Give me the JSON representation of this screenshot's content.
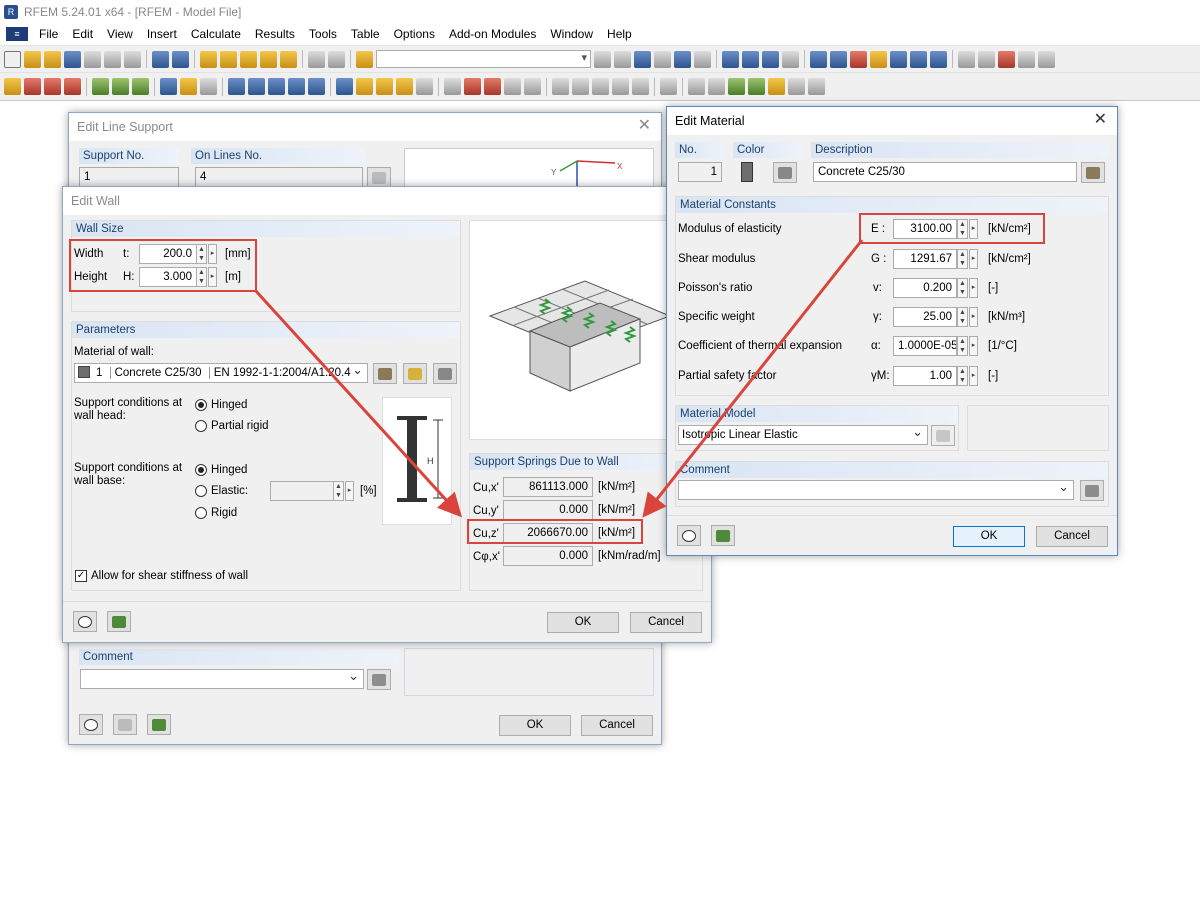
{
  "window": {
    "title": "RFEM 5.24.01 x64 - [RFEM - Model File]"
  },
  "menu": [
    "File",
    "Edit",
    "View",
    "Insert",
    "Calculate",
    "Results",
    "Tools",
    "Table",
    "Options",
    "Add-on Modules",
    "Window",
    "Help"
  ],
  "line_support": {
    "title": "Edit Line Support",
    "support_no_label": "Support No.",
    "support_no": "1",
    "on_lines_label": "On Lines No.",
    "on_lines": "4",
    "comment_label": "Comment",
    "ok": "OK",
    "cancel": "Cancel",
    "axis_y": "Y",
    "axis_x": "X"
  },
  "wall": {
    "title": "Edit Wall",
    "size_header": "Wall Size",
    "width_label": "Width",
    "width_sym": "t:",
    "width_value": "200.0",
    "width_unit": "[mm]",
    "height_label": "Height",
    "height_sym": "H:",
    "height_value": "3.000",
    "height_unit": "[m]",
    "params_header": "Parameters",
    "material_label": "Material of wall:",
    "material_no": "1",
    "material_name": "Concrete C25/30",
    "material_norm": "EN 1992-1-1:2004/A1:20.4",
    "head_label_1": "Support conditions at",
    "head_label_2": "wall head:",
    "head_hinged": "Hinged",
    "head_partial": "Partial rigid",
    "base_label_1": "Support conditions at",
    "base_label_2": "wall base:",
    "base_hinged": "Hinged",
    "base_elastic": "Elastic:",
    "base_elastic_unit": "[%]",
    "base_rigid": "Rigid",
    "shear_label": "Allow for shear stiffness of wall",
    "diagram_label": "H",
    "springs_header": "Support Springs Due to Wall",
    "springs": [
      {
        "sym": "Cu,x'",
        "value": "861113.000",
        "unit": "[kN/m²]"
      },
      {
        "sym": "Cu,y'",
        "value": "0.000",
        "unit": "[kN/m²]"
      },
      {
        "sym": "Cu,z'",
        "value": "2066670.00",
        "unit": "[kN/m²]"
      },
      {
        "sym": "Cφ,x'",
        "value": "0.000",
        "unit": "[kNm/rad/m]"
      }
    ],
    "ok": "OK",
    "cancel": "Cancel"
  },
  "material": {
    "title": "Edit Material",
    "no_label": "No.",
    "no": "1",
    "color_label": "Color",
    "desc_label": "Description",
    "desc": "Concrete C25/30",
    "constants_header": "Material Constants",
    "constants": [
      {
        "label": "Modulus of elasticity",
        "sym": "E :",
        "value": "3100.00",
        "unit": "[kN/cm²]"
      },
      {
        "label": "Shear modulus",
        "sym": "G :",
        "value": "1291.67",
        "unit": "[kN/cm²]"
      },
      {
        "label": "Poisson's ratio",
        "sym": "v:",
        "value": "0.200",
        "unit": "[-]"
      },
      {
        "label": "Specific weight",
        "sym": "γ:",
        "value": "25.00",
        "unit": "[kN/m³]"
      },
      {
        "label": "Coefficient of thermal expansion",
        "sym": "α:",
        "value": "1.0000E-05",
        "unit": "[1/°C]"
      },
      {
        "label": "Partial safety factor",
        "sym": "γM:",
        "value": "1.00",
        "unit": "[-]"
      }
    ],
    "model_header": "Material Model",
    "model": "Isotropic Linear Elastic",
    "comment_label": "Comment",
    "ok": "OK",
    "cancel": "Cancel"
  },
  "colors": {
    "highlight": "#d9453c",
    "material_swatch": "#6e6e6e"
  }
}
